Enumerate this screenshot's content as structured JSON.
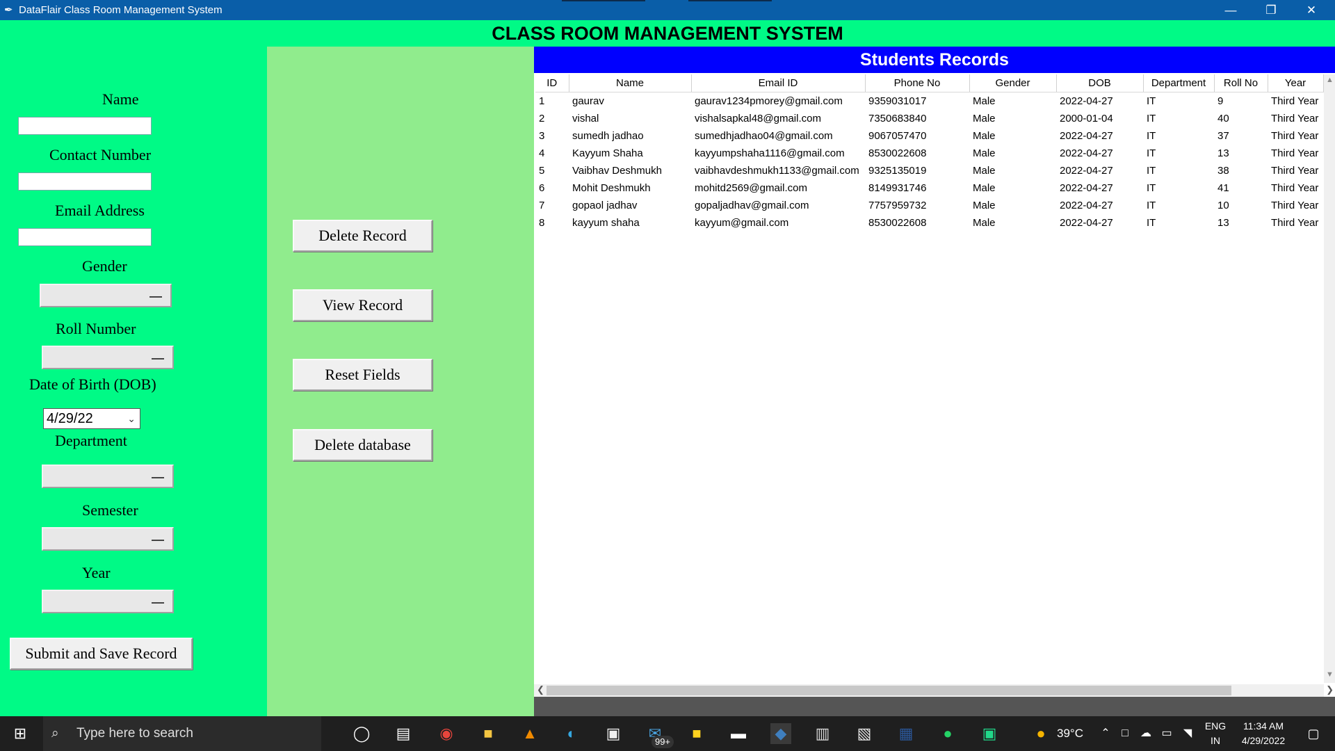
{
  "window": {
    "title": "DataFlair Class Room Management System",
    "app_icon": "feather-icon",
    "minimize": "—",
    "restore": "❐",
    "close": "✕"
  },
  "header": {
    "title": "CLASS ROOM MANAGEMENT SYSTEM"
  },
  "form": {
    "name_label": "Name",
    "name_value": "",
    "contact_label": "Contact Number",
    "contact_value": "",
    "email_label": "Email Address",
    "email_value": "",
    "gender_label": "Gender",
    "gender_value": "",
    "roll_label": "Roll Number",
    "roll_value": "",
    "dob_label": "Date of Birth (DOB)",
    "dob_value": "4/29/22",
    "department_label": "Department",
    "department_value": "",
    "semester_label": "Semester",
    "semester_value": "",
    "year_label": "Year",
    "year_value": "",
    "submit_label": "Submit and Save Record"
  },
  "actions": {
    "delete_record": "Delete Record",
    "view_record": "View Record",
    "reset_fields": "Reset Fields",
    "delete_database": "Delete database"
  },
  "records": {
    "title": "Students Records",
    "columns": [
      "ID",
      "Name",
      "Email ID",
      "Phone No",
      "Gender",
      "DOB",
      "Department",
      "Roll No",
      "Year"
    ],
    "rows": [
      [
        "1",
        "gaurav",
        "gaurav1234pmorey@gmail.com",
        "9359031017",
        "Male",
        "2022-04-27",
        "IT",
        "9",
        "Third Year"
      ],
      [
        "2",
        "vishal",
        "vishalsapkal48@gmail.com",
        "7350683840",
        "Male",
        "2000-01-04",
        "IT",
        "40",
        "Third Year"
      ],
      [
        "3",
        "sumedh jadhao",
        "sumedhjadhao04@gmail.com",
        "9067057470",
        "Male",
        "2022-04-27",
        "IT",
        "37",
        "Third Year"
      ],
      [
        "4",
        "Kayyum Shaha",
        "kayyumpshaha1116@gmail.com",
        "8530022608",
        "Male",
        "2022-04-27",
        "IT",
        "13",
        "Third Year"
      ],
      [
        "5",
        "Vaibhav Deshmukh",
        "vaibhavdeshmukh1133@gmail.com",
        "9325135019",
        "Male",
        "2022-04-27",
        "IT",
        "38",
        "Third Year"
      ],
      [
        "6",
        "Mohit Deshmukh",
        "mohitd2569@gmail.com",
        "8149931746",
        "Male",
        "2022-04-27",
        "IT",
        "41",
        "Third Year"
      ],
      [
        "7",
        "gopaol jadhav",
        "gopaljadhav@gmail.com",
        "7757959732",
        "Male",
        "2022-04-27",
        "IT",
        "10",
        "Third Year"
      ],
      [
        "8",
        "kayyum shaha",
        "kayyum@gmail.com",
        "8530022608",
        "Male",
        "2022-04-27",
        "IT",
        "13",
        "Third Year"
      ]
    ]
  },
  "taskbar": {
    "search_placeholder": "Type here to search",
    "mail_badge": "99+",
    "weather": "39°C",
    "lang_top": "ENG",
    "lang_bottom": "IN",
    "time": "11:34 AM",
    "date": "4/29/2022"
  },
  "colors": {
    "titlebar": "#0a5ea8",
    "form_bg": "#00fa86",
    "buttons_panel_bg": "#90ec8d",
    "records_header_bg": "#0000ff",
    "taskbar_bg": "#1f1f1f"
  }
}
